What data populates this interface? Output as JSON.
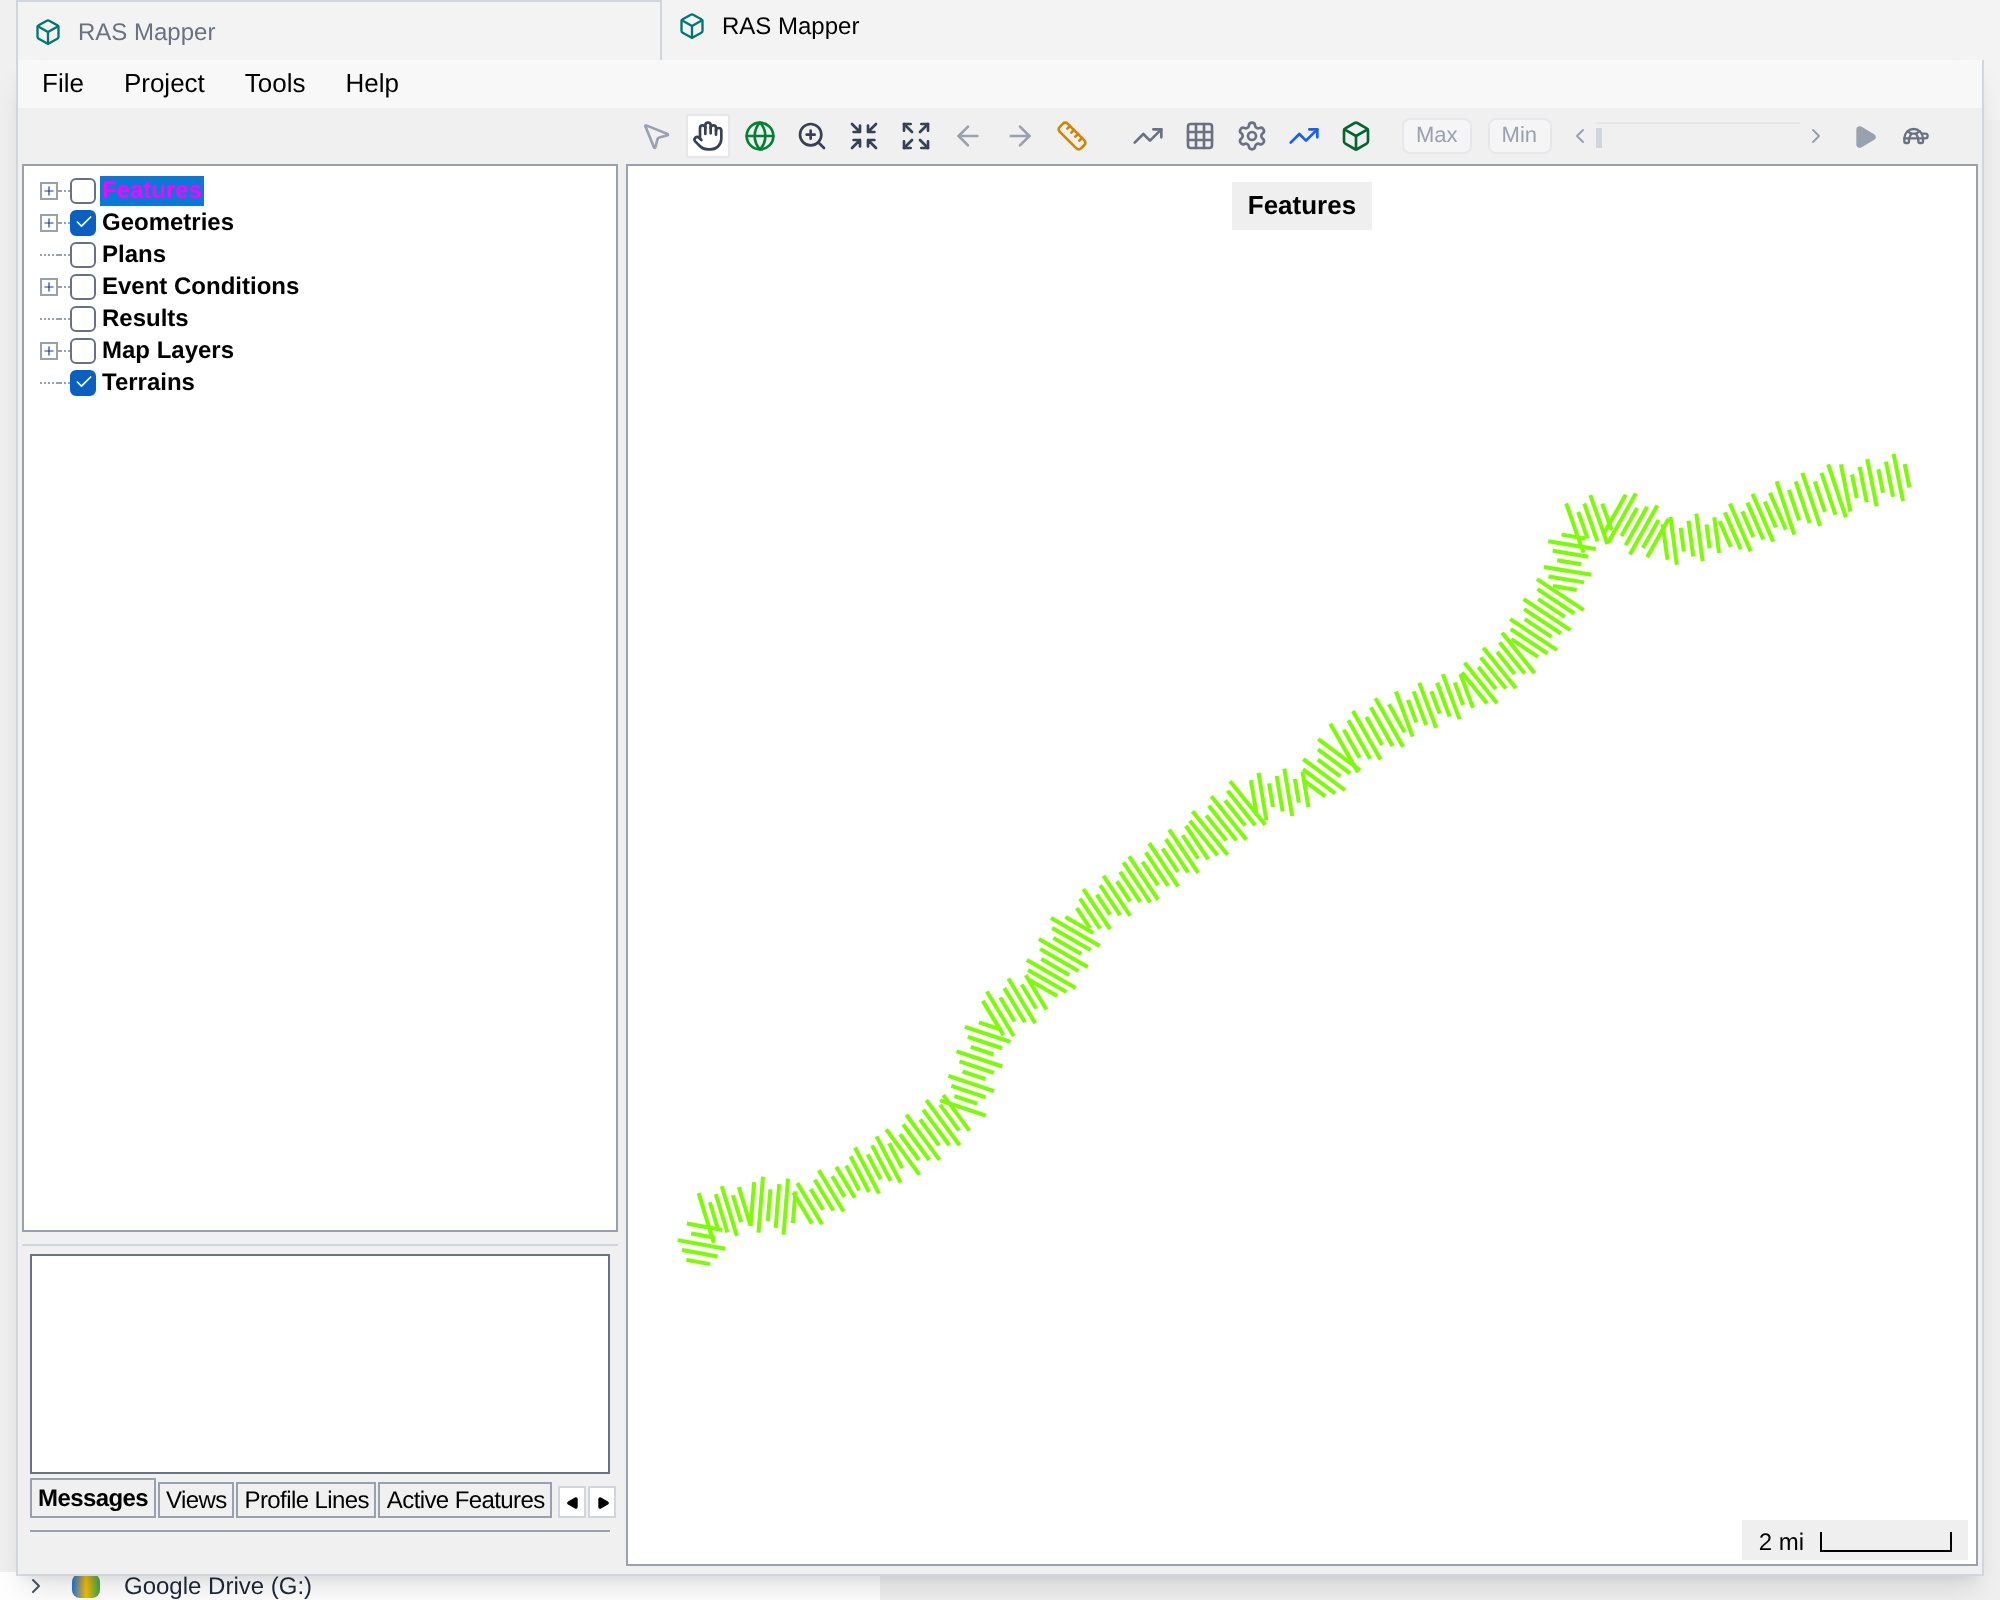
{
  "background_window": {
    "title": "RAS Mapper"
  },
  "taskbar_item": {
    "label": "Google Drive (G:)"
  },
  "window": {
    "title": "RAS Mapper"
  },
  "menu": [
    "File",
    "Project",
    "Tools",
    "Help"
  ],
  "toolbar": [
    {
      "kind": "pointer",
      "selected": false
    },
    {
      "kind": "hand",
      "selected": true
    },
    {
      "kind": "globe",
      "selected": false
    },
    {
      "kind": "zoom",
      "selected": false
    },
    {
      "kind": "shrink",
      "selected": false
    },
    {
      "kind": "expand",
      "selected": false
    },
    {
      "kind": "back",
      "selected": false
    },
    {
      "kind": "forward",
      "selected": false
    },
    {
      "kind": "ruler",
      "selected": false
    },
    {
      "kind": "gap"
    },
    {
      "kind": "chart",
      "selected": false
    },
    {
      "kind": "grid",
      "selected": false
    },
    {
      "kind": "gear",
      "selected": false
    },
    {
      "kind": "profile",
      "selected": false
    },
    {
      "kind": "cube",
      "selected": false
    }
  ],
  "time_controls": {
    "max": "Max",
    "min": "Min",
    "level": 0
  },
  "layers": [
    {
      "label": "Features",
      "checked": false,
      "expandable": true,
      "selected": true
    },
    {
      "label": "Geometries",
      "checked": true,
      "expandable": true,
      "selected": false
    },
    {
      "label": "Plans",
      "checked": false,
      "expandable": false,
      "selected": false
    },
    {
      "label": "Event Conditions",
      "checked": false,
      "expandable": true,
      "selected": false
    },
    {
      "label": "Results",
      "checked": false,
      "expandable": false,
      "selected": false
    },
    {
      "label": "Map Layers",
      "checked": false,
      "expandable": true,
      "selected": false
    },
    {
      "label": "Terrains",
      "checked": true,
      "expandable": false,
      "selected": false
    }
  ],
  "tabs": [
    {
      "label": "Messages",
      "selected": true
    },
    {
      "label": "Views",
      "selected": false
    },
    {
      "label": "Profile Lines",
      "selected": false
    },
    {
      "label": "Active Features",
      "selected": false
    }
  ],
  "map": {
    "title": "Features",
    "scale": "2 mi"
  }
}
